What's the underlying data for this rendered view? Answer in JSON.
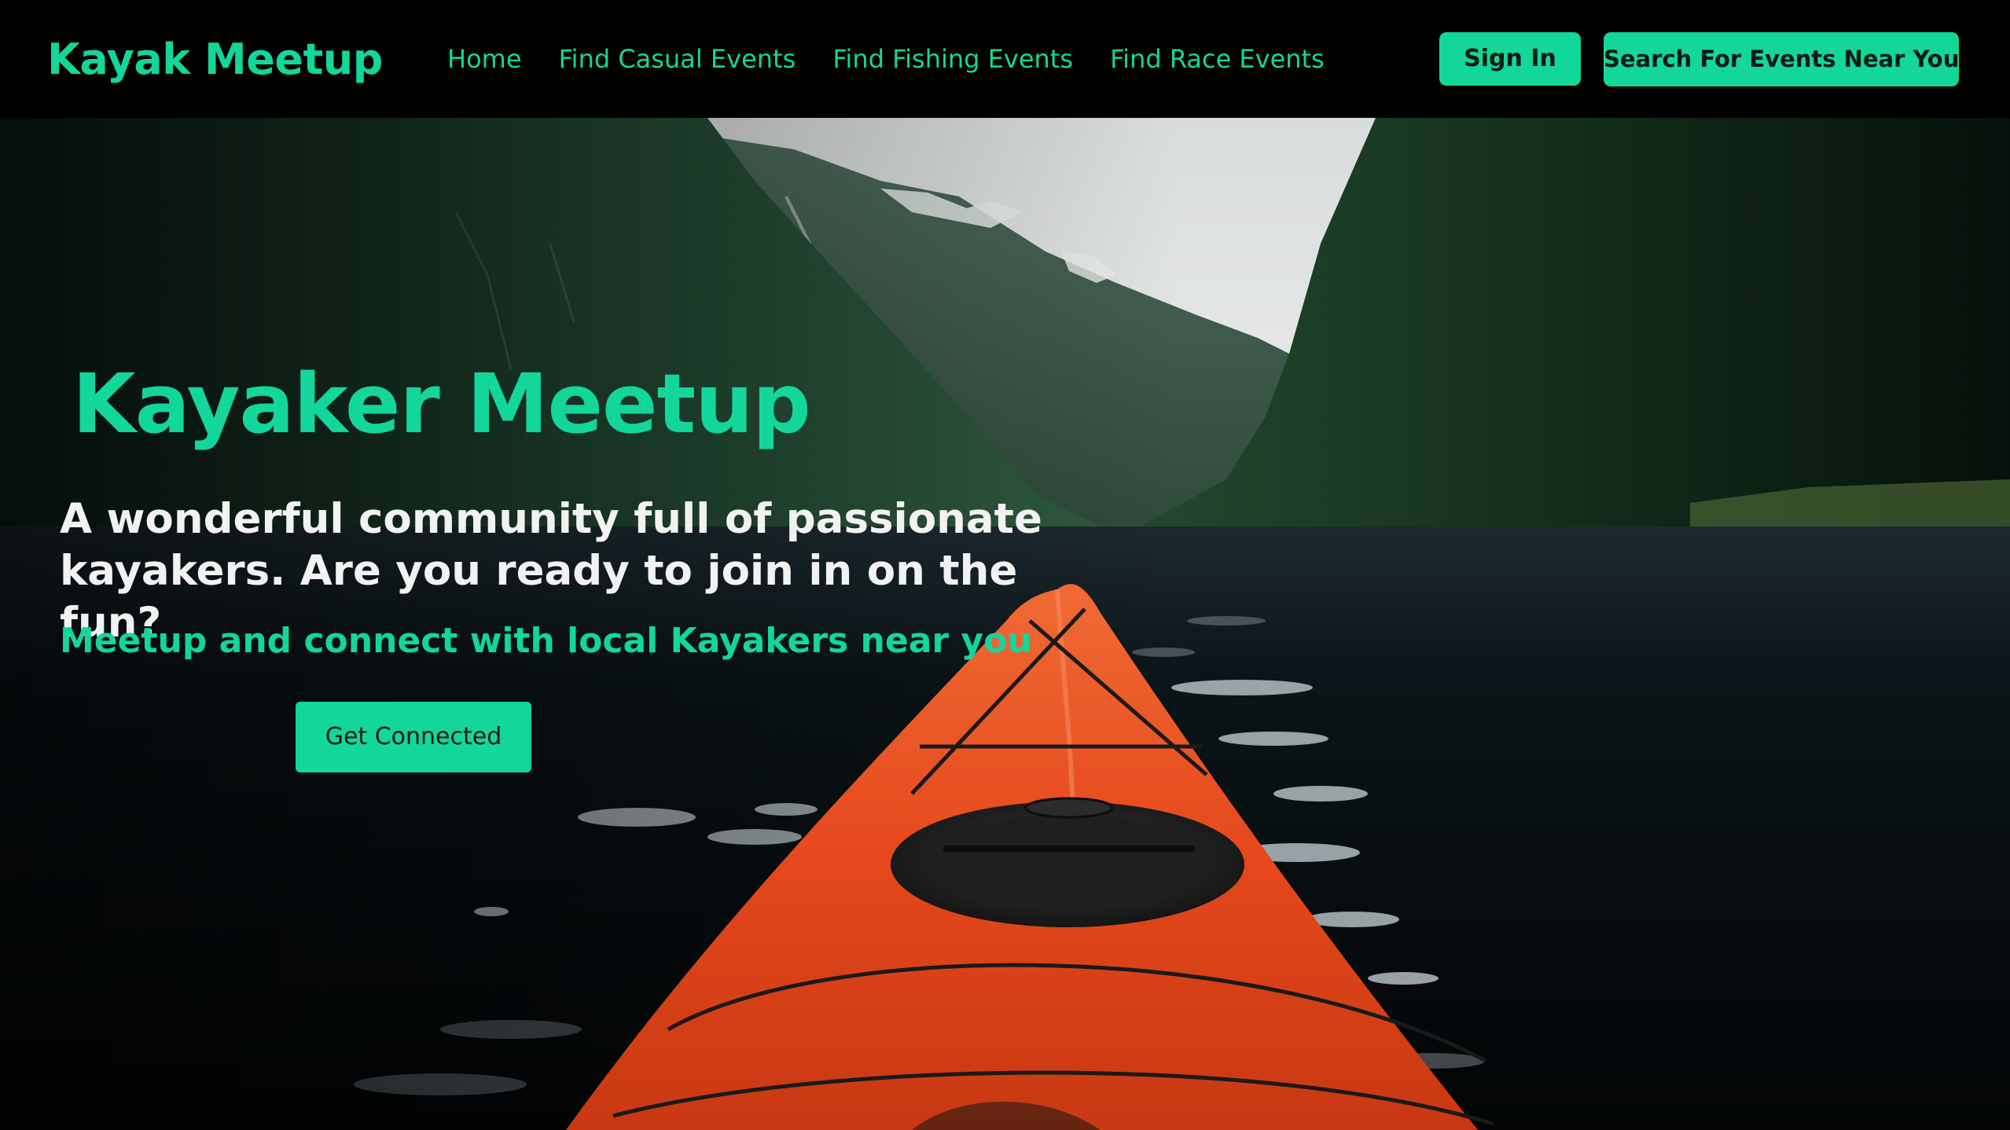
{
  "nav": {
    "brand": "Kayak Meetup",
    "links": [
      "Home",
      "Find Casual Events",
      "Find Fishing Events",
      "Find Race Events"
    ],
    "signin": "Sign In",
    "search": "Search For Events Near You"
  },
  "hero": {
    "title": "Kayaker Meetup",
    "description": "A wonderful community full of passionate kayakers. Are you ready to join in on the fun?",
    "subtitle": "Meetup and connect with local Kayakers near you",
    "cta": "Get Connected"
  },
  "colors": {
    "accent": "#13d69a",
    "navbar_bg": "#000000",
    "kayak": "#e5481c",
    "water": "#05090b"
  }
}
